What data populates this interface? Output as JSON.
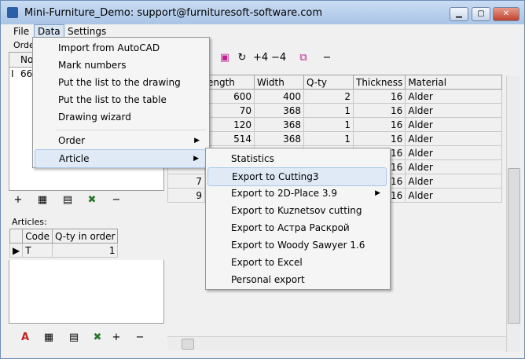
{
  "window": {
    "title": "Mini-Furniture_Demo: support@furnituresoft-software.com"
  },
  "menubar": {
    "file": "File",
    "data": "Data",
    "settings": "Settings"
  },
  "data_menu": {
    "items": [
      "Import from AutoCAD",
      "Mark numbers",
      "Put the list to the drawing",
      "Put the list to the table",
      "Drawing wizard",
      "Order",
      "Article"
    ],
    "highlighted": "Article"
  },
  "article_submenu": {
    "items": [
      "Statistics",
      "Export to Cutting3",
      "Export to 2D-Place 3.9",
      "Export to Kuznetsov cutting",
      "Export to Астра Раскрой",
      "Export to Woody Sawyer 1.6",
      "Export to Excel",
      "Personal export"
    ],
    "highlighted": "Export to Cutting3"
  },
  "orders": {
    "label": "Orde",
    "col_no": "No",
    "row_value": "66"
  },
  "articles": {
    "label": "Articles:",
    "col_code": "Code",
    "col_qty": "Q-ty in order",
    "rows": [
      {
        "code": "T",
        "qty": "1"
      }
    ]
  },
  "toolbar": {
    "plus4": "+4",
    "minus4": "−4",
    "minus": "−"
  },
  "parts": {
    "headers": [
      "ength",
      "Width",
      "Q-ty",
      "Thickness",
      "Material"
    ],
    "rows": [
      {
        "no": "",
        "length": "600",
        "width": "400",
        "qty": "2",
        "thickness": "16",
        "material": "Alder"
      },
      {
        "no": "",
        "length": "70",
        "width": "368",
        "qty": "1",
        "thickness": "16",
        "material": "Alder"
      },
      {
        "no": "",
        "length": "120",
        "width": "368",
        "qty": "1",
        "thickness": "16",
        "material": "Alder"
      },
      {
        "no": "",
        "length": "514",
        "width": "368",
        "qty": "1",
        "thickness": "16",
        "material": "Alder"
      },
      {
        "no": "",
        "length": "",
        "width": "",
        "qty": "",
        "thickness": "16",
        "material": "Alder"
      },
      {
        "no": "",
        "length": "",
        "width": "",
        "qty": "",
        "thickness": "16",
        "material": "Alder"
      },
      {
        "no": "7",
        "length": "",
        "width": "",
        "qty": "",
        "thickness": "16",
        "material": "Alder"
      },
      {
        "no": "9",
        "length": "",
        "width": "",
        "qty": "",
        "thickness": "16",
        "material": "Alder"
      }
    ]
  },
  "colors": {
    "highlight": "#dfeaf6",
    "titlebar": "#b9d0ec"
  }
}
